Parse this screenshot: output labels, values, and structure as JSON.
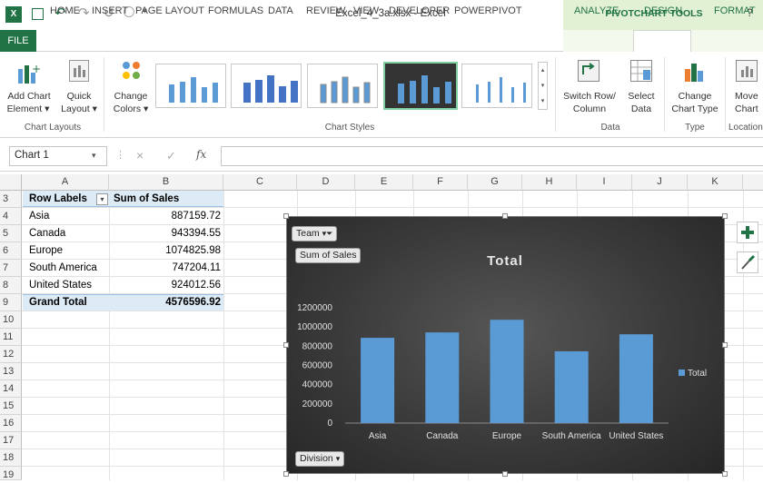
{
  "window": {
    "title": "Excel_4_3a.xlsx - Excel",
    "contextual_tools": "PIVOTCHART TOOLS",
    "help": "?"
  },
  "qat": {
    "undo": "↶",
    "redo": "↷"
  },
  "tabs": [
    "FILE",
    "HOME",
    "INSERT",
    "PAGE LAYOUT",
    "FORMULAS",
    "DATA",
    "REVIEW",
    "VIEW",
    "DEVELOPER",
    "POWERPIVOT",
    "ANALYZE",
    "DESIGN",
    "FORMAT"
  ],
  "ribbon": {
    "add_chart_element": [
      "Add Chart",
      "Element ▾"
    ],
    "quick_layout": [
      "Quick",
      "Layout ▾"
    ],
    "change_colors": [
      "Change",
      "Colors ▾"
    ],
    "group_chart_layouts": "Chart Layouts",
    "group_chart_styles": "Chart Styles",
    "switch_row_col": [
      "Switch Row/",
      "Column"
    ],
    "select_data": [
      "Select",
      "Data"
    ],
    "group_data": "Data",
    "change_chart_type": [
      "Change",
      "Chart Type"
    ],
    "group_type": "Type",
    "move_chart": [
      "Move",
      "Chart"
    ],
    "group_location": "Location"
  },
  "formula_bar": {
    "name_box": "Chart 1",
    "fx": "fx",
    "cancel": "×",
    "enter": "✓",
    "value": ""
  },
  "columns": [
    "A",
    "B",
    "C",
    "D",
    "E",
    "F",
    "G",
    "H",
    "I",
    "J",
    "K"
  ],
  "rows": [
    "3",
    "4",
    "5",
    "6",
    "7",
    "8",
    "9",
    "10",
    "11",
    "12",
    "13",
    "14",
    "15",
    "16",
    "17",
    "18",
    "19"
  ],
  "pivot": {
    "header_labels": "Row Labels",
    "header_values": "Sum of Sales",
    "rows": [
      {
        "label": "Asia",
        "value": "887159.72"
      },
      {
        "label": "Canada",
        "value": "943394.55"
      },
      {
        "label": "Europe",
        "value": "1074825.98"
      },
      {
        "label": "South America",
        "value": "747204.11"
      },
      {
        "label": "United States",
        "value": "924012.56"
      }
    ],
    "grand_total_label": "Grand Total",
    "grand_total_value": "4576596.92"
  },
  "chart_buttons": {
    "team": "Team",
    "sum_of_sales": "Sum of Sales",
    "division": "Division"
  },
  "chart_data": {
    "type": "bar",
    "title": "Total",
    "categories": [
      "Asia",
      "Canada",
      "Europe",
      "South America",
      "United States"
    ],
    "series": [
      {
        "name": "Total",
        "values": [
          887159.72,
          943394.55,
          1074825.98,
          747204.11,
          924012.56
        ]
      }
    ],
    "yticks": [
      "0",
      "200000",
      "400000",
      "600000",
      "800000",
      "1000000",
      "1200000"
    ],
    "ylim": [
      0,
      1200000
    ],
    "grid": false,
    "legend": "right",
    "colors": {
      "bar": "#5b9bd5",
      "background": "#3a3a3a"
    }
  },
  "colors": {
    "excel_green": "#217346",
    "pivot_header": "#ddebf7"
  }
}
